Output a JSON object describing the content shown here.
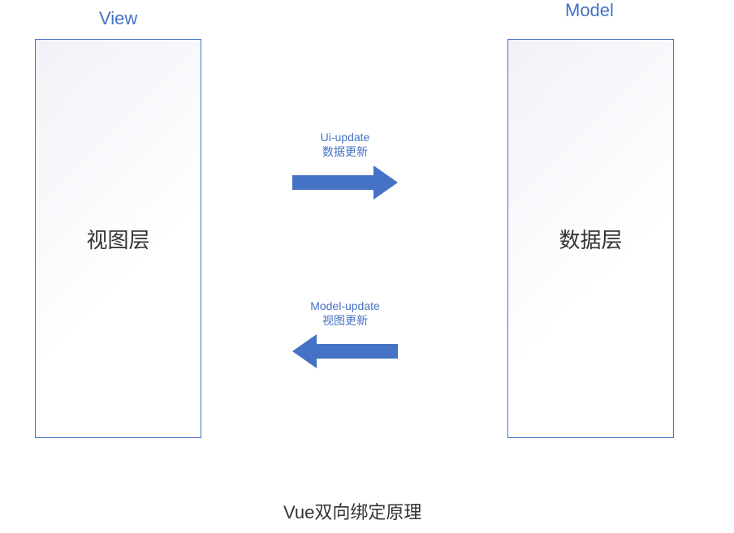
{
  "headers": {
    "view": "View",
    "model": "Model"
  },
  "boxes": {
    "view_label": "视图层",
    "model_label": "数据层"
  },
  "arrows": {
    "top": {
      "line1": "Ui-update",
      "line2": "数据更新"
    },
    "bottom": {
      "line1": "Model-update",
      "line2": "视图更新"
    }
  },
  "caption": "Vue双向绑定原理",
  "colors": {
    "accent": "#4472C4"
  }
}
